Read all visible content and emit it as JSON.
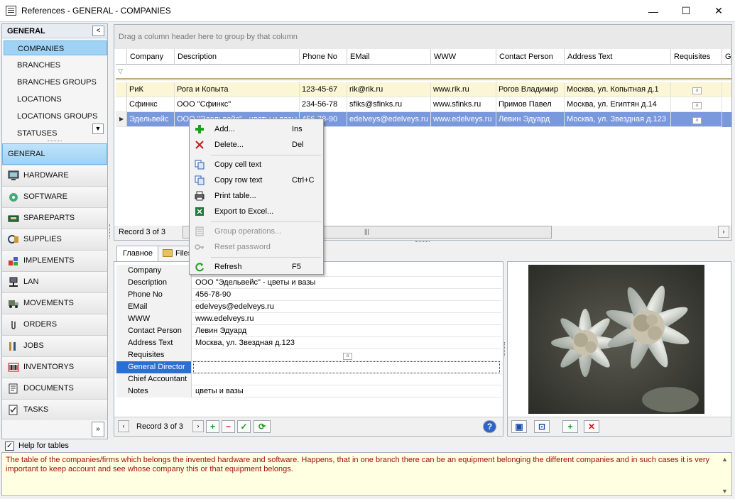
{
  "window": {
    "title": "References - GENERAL - COMPANIES",
    "controls": [
      "—",
      "☐",
      "✕"
    ]
  },
  "left_panel": {
    "section_title": "GENERAL",
    "sub_items": [
      "COMPANIES",
      "BRANCHES",
      "BRANCHES GROUPS",
      "LOCATIONS",
      "LOCATIONS GROUPS",
      "STATUSES"
    ],
    "selected_sub_item": "COMPANIES",
    "nav_items": [
      {
        "label": "GENERAL",
        "icon": "general-icon"
      },
      {
        "label": "HARDWARE",
        "icon": "monitor-icon"
      },
      {
        "label": "SOFTWARE",
        "icon": "software-icon"
      },
      {
        "label": "SPAREPARTS",
        "icon": "chip-icon"
      },
      {
        "label": "SUPPLIES",
        "icon": "supplies-icon"
      },
      {
        "label": "IMPLEMENTS",
        "icon": "implements-icon"
      },
      {
        "label": "LAN",
        "icon": "lan-icon"
      },
      {
        "label": "MOVEMENTS",
        "icon": "truck-icon"
      },
      {
        "label": "ORDERS",
        "icon": "paperclip-icon"
      },
      {
        "label": "JOBS",
        "icon": "tools-icon"
      },
      {
        "label": "INVENTORYS",
        "icon": "barcode-icon"
      },
      {
        "label": "DOCUMENTS",
        "icon": "documents-icon"
      },
      {
        "label": "TASKS",
        "icon": "tasks-icon"
      }
    ],
    "selected_nav": "GENERAL"
  },
  "grid": {
    "group_hint": "Drag a column header here to group by that column",
    "columns": [
      "Company",
      "Description",
      "Phone No",
      "EMail",
      "WWW",
      "Contact Person",
      "Address Text",
      "Requisites",
      "G"
    ],
    "rows": [
      [
        "РиК",
        "Рога и Копыта",
        "123-45-67",
        "rik@rik.ru",
        "www.rik.ru",
        "Рогов Владимир",
        "Москва, ул. Копытная д.1"
      ],
      [
        "Сфинкс",
        "ООО \"Сфинкс\"",
        "234-56-78",
        "sfiks@sfinks.ru",
        "www.sfinks.ru",
        "Примов Павел",
        "Москва, ул. Египтян д.14"
      ],
      [
        "Эдельвейс",
        "ООО \"Эдельвейс\" - цветы и вазы",
        "456-78-90",
        "edelveys@edelveys.ru",
        "www.edelveys.ru",
        "Левин Эдуард",
        "Москва, ул. Звездная д.123"
      ]
    ],
    "selected_row": 2,
    "record_text": "Record 3 of 3"
  },
  "context_menu": {
    "items": [
      {
        "label": "Add...",
        "shortcut": "Ins",
        "icon": "add-icon",
        "enabled": true
      },
      {
        "label": "Delete...",
        "shortcut": "Del",
        "icon": "delete-icon",
        "enabled": true
      },
      {
        "label": "Copy cell text",
        "shortcut": "",
        "icon": "copy-icon",
        "enabled": true
      },
      {
        "label": "Copy row text",
        "shortcut": "Ctrl+C",
        "icon": "copy-row-icon",
        "enabled": true
      },
      {
        "label": "Print table...",
        "shortcut": "",
        "icon": "printer-icon",
        "enabled": true
      },
      {
        "label": "Export to Excel...",
        "shortcut": "",
        "icon": "excel-icon",
        "enabled": true
      },
      {
        "label": "Group operations...",
        "shortcut": "",
        "icon": "group-ops-icon",
        "enabled": false
      },
      {
        "label": "Reset password",
        "shortcut": "",
        "icon": "key-icon",
        "enabled": false
      },
      {
        "label": "Refresh",
        "shortcut": "F5",
        "icon": "refresh-icon",
        "enabled": true
      }
    ]
  },
  "tabs": [
    "Главное",
    "Files"
  ],
  "detail": {
    "fields": [
      {
        "label": "Company",
        "value": ""
      },
      {
        "label": "Description",
        "value": "ООО \"Эдельвейс\" - цветы и вазы"
      },
      {
        "label": "Phone No",
        "value": "456-78-90"
      },
      {
        "label": "EMail",
        "value": "edelveys@edelveys.ru"
      },
      {
        "label": "WWW",
        "value": "www.edelveys.ru"
      },
      {
        "label": "Contact Person",
        "value": "Левин Эдуард"
      },
      {
        "label": "Address Text",
        "value": "Москва, ул. Звездная д.123"
      },
      {
        "label": "Requisites",
        "value": ""
      },
      {
        "label": "General Director",
        "value": ""
      },
      {
        "label": "Chief Accountant",
        "value": ""
      },
      {
        "label": "Notes",
        "value": "цветы и вазы"
      }
    ],
    "selected_field": "General Director",
    "record_text": "Record 3 of 3"
  },
  "help": {
    "checkbox_label": "Help for tables",
    "checked": true,
    "text": "The table of the companies/firms which belongs the invented hardware and software. Happens, that in one branch there can be an equipment belonging the different companies and in such cases it is very important to keep account and see whose company this or that equipment belongs."
  },
  "colors": {
    "selected_row": "#7a98dc",
    "first_row": "#fbf7d6",
    "help_text": "#a01010",
    "help_bg": "#ffffe1"
  }
}
